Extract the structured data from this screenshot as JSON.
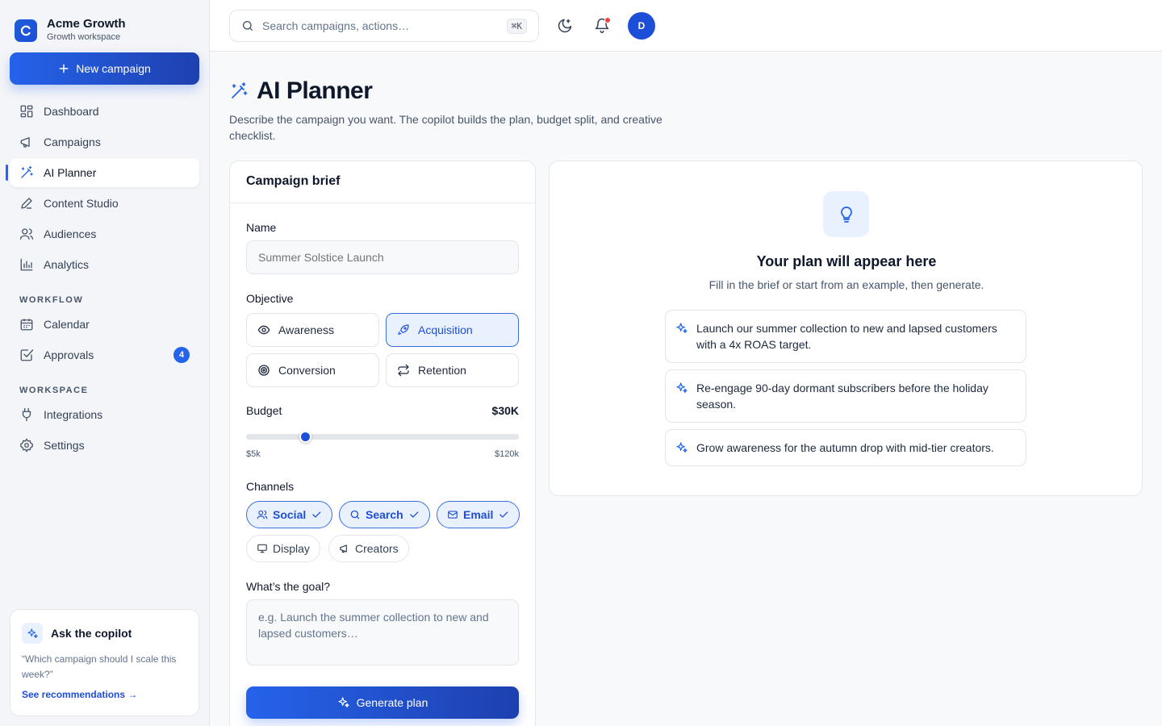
{
  "colors": {
    "accent": "#2563eb",
    "accent_dark": "#1e40af",
    "badge_red": "#ef4444"
  },
  "brand": {
    "name": "Acme Growth",
    "subtitle": "Growth workspace",
    "logo_icon": "brand-logo-icon"
  },
  "sidebar": {
    "new_campaign": "New campaign",
    "main_items": [
      {
        "label": "Dashboard",
        "icon": "grid-icon"
      },
      {
        "label": "Campaigns",
        "icon": "megaphone-icon"
      },
      {
        "label": "AI Planner",
        "icon": "magic-wand-icon",
        "active": true
      },
      {
        "label": "Content Studio",
        "icon": "pen-icon"
      },
      {
        "label": "Audiences",
        "icon": "users-icon"
      },
      {
        "label": "Analytics",
        "icon": "bar-chart-icon"
      }
    ],
    "workflow_label": "WORKFLOW",
    "workflow_items": [
      {
        "label": "Calendar",
        "icon": "calendar-icon"
      },
      {
        "label": "Approvals",
        "icon": "check-square-icon",
        "badge": "4"
      }
    ],
    "workspace_label": "WORKSPACE",
    "workspace_items": [
      {
        "label": "Integrations",
        "icon": "plug-icon"
      },
      {
        "label": "Settings",
        "icon": "gear-icon"
      }
    ],
    "copilot": {
      "title": "Ask the copilot",
      "quote": "“Which campaign should I scale this week?”",
      "link": "See recommendations →"
    }
  },
  "topbar": {
    "search_placeholder": "Search campaigns, actions…",
    "shortcut": "⌘K",
    "avatar_initial": "D"
  },
  "page": {
    "title": "AI Planner",
    "description": "Describe the campaign you want. The copilot builds the plan, budget split, and creative checklist."
  },
  "brief": {
    "heading": "Campaign brief",
    "name_label": "Name",
    "name_placeholder": "Summer Solstice Launch",
    "objective_label": "Objective",
    "objectives": [
      {
        "label": "Awareness",
        "icon": "eye-icon",
        "selected": false
      },
      {
        "label": "Acquisition",
        "icon": "rocket-icon",
        "selected": true
      },
      {
        "label": "Conversion",
        "icon": "target-icon",
        "selected": false
      },
      {
        "label": "Retention",
        "icon": "repeat-icon",
        "selected": false
      }
    ],
    "budget_label": "Budget",
    "budget_value": "$30K",
    "budget_fraction": 0.217,
    "budget_min": "$5k",
    "budget_max": "$120k",
    "channels_label": "Channels",
    "channels": [
      {
        "label": "Social",
        "icon": "users-icon",
        "selected": true
      },
      {
        "label": "Search",
        "icon": "search-icon",
        "selected": true
      },
      {
        "label": "Email",
        "icon": "mail-icon",
        "selected": true
      },
      {
        "label": "Display",
        "icon": "monitor-icon",
        "selected": false
      },
      {
        "label": "Creators",
        "icon": "megaphone-icon",
        "selected": false
      }
    ],
    "goal_label": "What’s the goal?",
    "goal_placeholder": "e.g. Launch the summer collection to new and lapsed customers…",
    "generate": "Generate plan"
  },
  "plan": {
    "title": "Your plan will appear here",
    "subtitle": "Fill in the brief or start from an example, then generate.",
    "examples": [
      "Launch our summer collection to new and lapsed customers with a 4x ROAS target.",
      "Re-engage 90-day dormant subscribers before the holiday season.",
      "Grow awareness for the autumn drop with mid-tier creators."
    ]
  }
}
